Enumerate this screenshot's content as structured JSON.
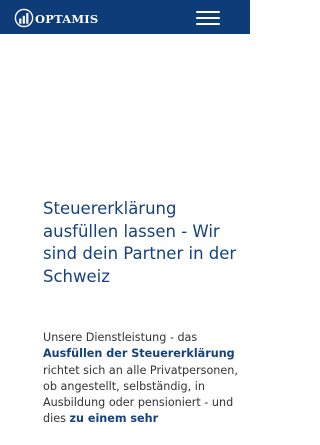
{
  "header": {
    "logo_text": "OPTAMIS",
    "logo_icon": "optamis-bar-chart-logo",
    "menu_icon": "hamburger-menu-icon",
    "background_color": "#0d3c78"
  },
  "hero": {
    "title": "Steuererklärung ausfüllen lassen - Wir sind dein Partner in der Schweiz",
    "title_color": "#15427e"
  },
  "intro": {
    "text_1": "Unsere Dienstleistung - das ",
    "bold_1": "Ausfüllen der Steuererklärung",
    "text_2": " richtet sich an alle Privatpersonen, ob angestellt, selbständig, in Ausbildung oder pensioniert - und dies ",
    "bold_2": "zu einem sehr"
  }
}
